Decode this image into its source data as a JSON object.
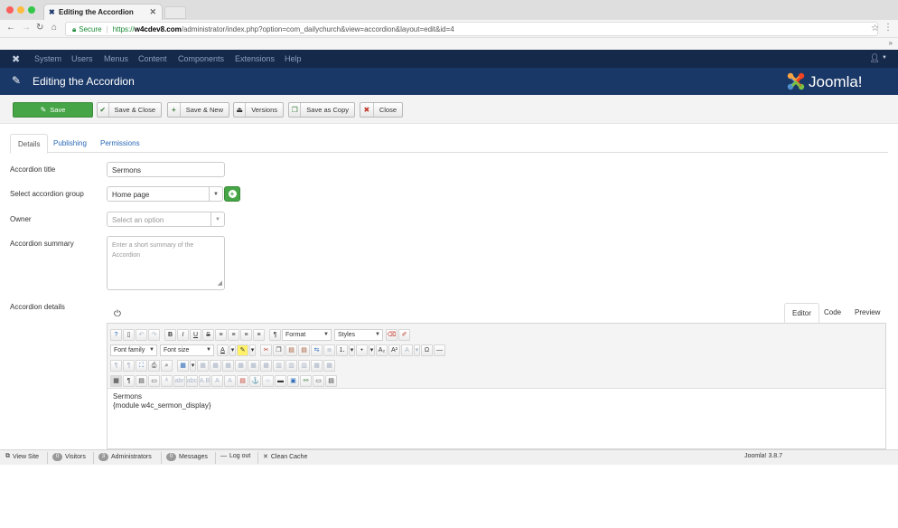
{
  "browser": {
    "tab_title": "Editing the Accordion",
    "tab_close": "✕",
    "url_secure_label": "Secure",
    "url_scheme": "https://",
    "url_domain": "w4cdev8.com",
    "url_path": "/administrator/index.php?option=com_dailychurch&view=accordion&layout=edit&id=4"
  },
  "admin_nav": {
    "items": [
      "System",
      "Users",
      "Menus",
      "Content",
      "Components",
      "Extensions",
      "Help"
    ]
  },
  "header": {
    "title": "Editing the Accordion",
    "brand": "Joomla!"
  },
  "toolbar": {
    "save": "Save",
    "save_close": "Save & Close",
    "save_new": "Save & New",
    "versions": "Versions",
    "save_copy": "Save as Copy",
    "close": "Close"
  },
  "tabs": [
    "Details",
    "Publishing",
    "Permissions"
  ],
  "form": {
    "title_label": "Accordion title",
    "title_value": "Sermons",
    "group_label": "Select accordion group",
    "group_value": "Home page",
    "owner_label": "Owner",
    "owner_placeholder": "Select an option",
    "summary_label": "Accordion summary",
    "summary_placeholder": "Enter a short summary of the Accordion",
    "details_label": "Accordion details"
  },
  "editor": {
    "tabs": [
      "Editor",
      "Code",
      "Preview"
    ],
    "format_label": "Format",
    "styles_label": "Styles",
    "font_family_label": "Font family",
    "font_size_label": "Font size",
    "content_line1": "Sermons",
    "content_line2": "{module w4c_sermon_display}"
  },
  "statusbar": {
    "view_site": "View Site",
    "visitors_count": "0",
    "visitors": "Visitors",
    "admins_count": "3",
    "admins": "Administrators",
    "messages_count": "0",
    "messages": "Messages",
    "logout": "Log out",
    "clean_cache": "Clean Cache",
    "version": "Joomla! 3.8.7"
  },
  "colors": {
    "nav_bg": "#15294b",
    "subhead_bg": "#1a3867",
    "save_green": "#46a546",
    "link_blue": "#2a69b8"
  }
}
